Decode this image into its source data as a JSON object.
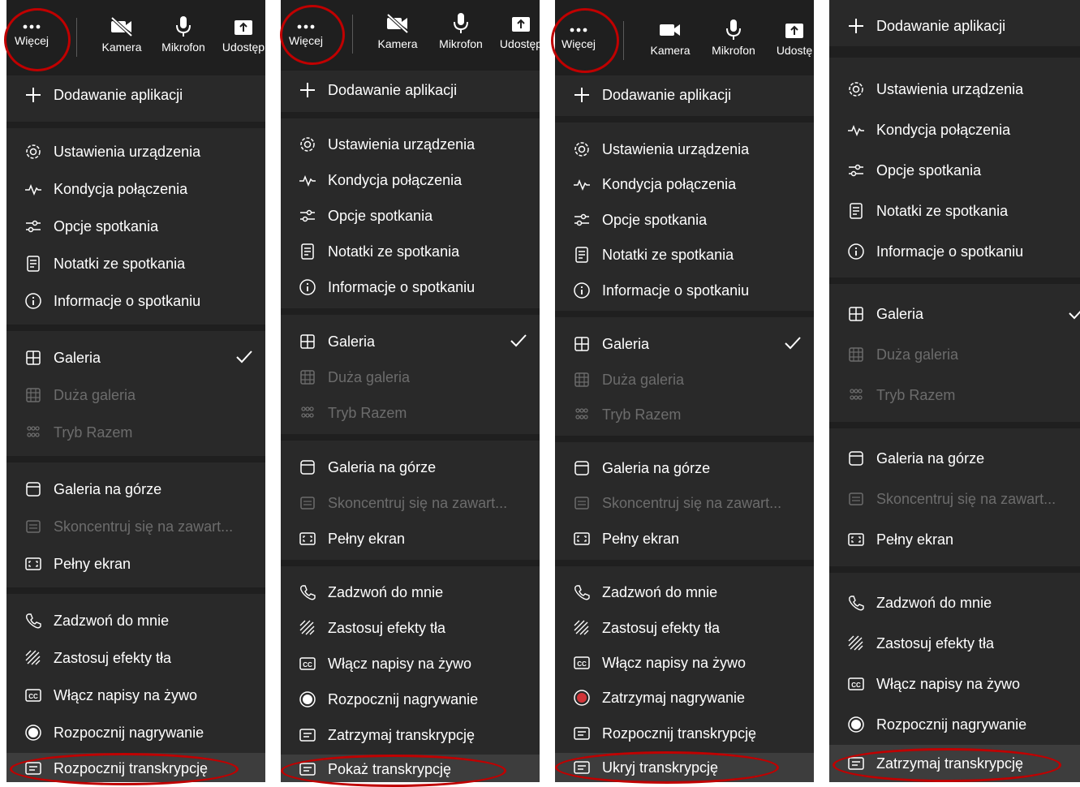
{
  "colors": {
    "panel": "#292929",
    "toolbar": "#1f1f1f",
    "dim": "#6c6c6c",
    "highlight": "#3d3d3d",
    "ring": "#c00000",
    "record_red": "#d13438"
  },
  "toolbar": {
    "more_label": "Więcej",
    "camera_label": "Kamera",
    "mic_label": "Mikrofon",
    "share_label_1": "Udostęp",
    "share_label_2": "Udostęp",
    "share_label_3": "Udostę"
  },
  "menu": {
    "add_apps": "Dodawanie aplikacji",
    "device_settings": "Ustawienia urządzenia",
    "call_health": "Kondycja połączenia",
    "meeting_options": "Opcje spotkania",
    "meeting_notes": "Notatki ze spotkania",
    "meeting_info": "Informacje o spotkaniu",
    "gallery": "Galeria",
    "large_gallery": "Duża galeria",
    "together_mode": "Tryb Razem",
    "gallery_top": "Galeria na górze",
    "focus_content": "Skoncentruj się na zawart...",
    "full_screen": "Pełny ekran",
    "call_me": "Zadzwoń do mnie",
    "bg_effects": "Zastosuj efekty tła",
    "live_captions": "Włącz napisy na żywo",
    "start_recording": "Rozpocznij nagrywanie",
    "stop_recording": "Zatrzymaj nagrywanie",
    "start_transcription": "Rozpocznij transkrypcję",
    "stop_transcription": "Zatrzymaj transkrypcję",
    "show_transcript": "Pokaż transkrypcję",
    "hide_transcript": "Ukryj transkrypcję"
  },
  "icons": [
    "more-icon",
    "camera-off-icon",
    "camera-icon",
    "mic-icon",
    "share-icon",
    "plus-icon",
    "gear-icon",
    "pulse-icon",
    "sliders-icon",
    "notes-icon",
    "info-icon",
    "grid-icon",
    "people-icon",
    "gallery-top-icon",
    "focus-icon",
    "fullscreen-icon",
    "phone-icon",
    "background-effects-icon",
    "captions-icon",
    "record-icon",
    "transcript-icon",
    "check-icon"
  ]
}
